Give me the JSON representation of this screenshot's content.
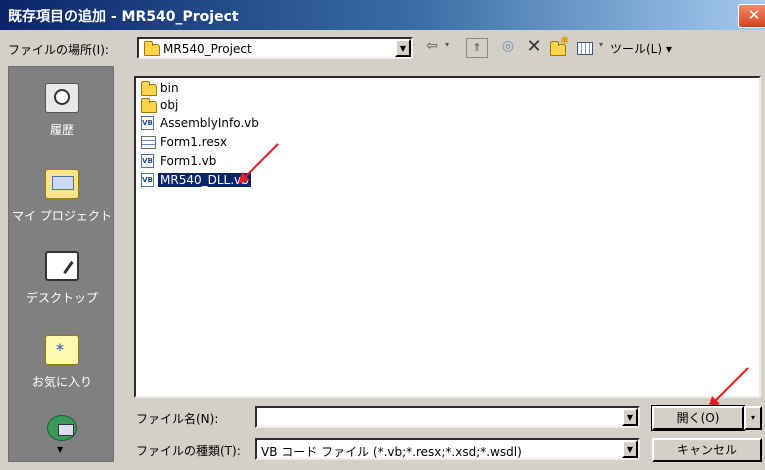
{
  "window": {
    "title": "既存項目の追加 - MR540_Project",
    "close_glyph": "✕"
  },
  "toolbar": {
    "lookin_label": "ファイルの場所(I):",
    "lookin_value": "MR540_Project",
    "tools_label": "ツール(L)",
    "icons": [
      "back-icon",
      "up-folder-icon",
      "search-web-icon",
      "delete-icon",
      "new-folder-icon",
      "views-icon"
    ]
  },
  "places": [
    {
      "label": "履歴",
      "icon": "history-icon"
    },
    {
      "label": "マイ プロジェクト",
      "icon": "my-projects-icon"
    },
    {
      "label": "デスクトップ",
      "icon": "desktop-icon"
    },
    {
      "label": "お気に入り",
      "icon": "favorites-icon"
    },
    {
      "label": "",
      "icon": "network-icon"
    }
  ],
  "files": [
    {
      "name": "bin",
      "type": "folder"
    },
    {
      "name": "obj",
      "type": "folder"
    },
    {
      "name": "AssemblyInfo.vb",
      "type": "vb"
    },
    {
      "name": "Form1.resx",
      "type": "resx"
    },
    {
      "name": "Form1.vb",
      "type": "vb"
    },
    {
      "name": "MR540_DLL.vb",
      "type": "vb",
      "selected": true
    }
  ],
  "filename": {
    "label": "ファイル名(N):",
    "value": ""
  },
  "filetype": {
    "label": "ファイルの種類(T):",
    "value": "VB コード ファイル (*.vb;*.resx;*.xsd;*.wsdl)"
  },
  "buttons": {
    "open": "開く(O)",
    "cancel": "キャンセル"
  },
  "colors": {
    "title_bar": "#0a246a",
    "selection": "#0a246a",
    "annotation_arrow": "#e02020"
  }
}
